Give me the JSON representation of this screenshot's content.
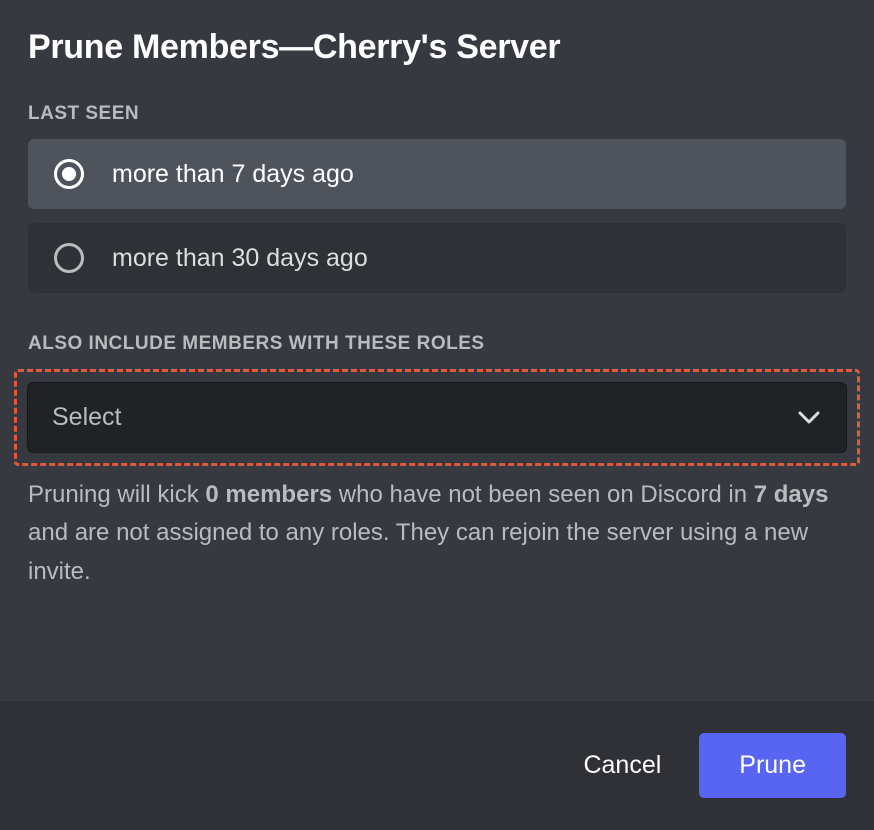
{
  "modal": {
    "title": "Prune Members—Cherry's Server"
  },
  "lastSeen": {
    "label": "Last Seen",
    "options": [
      {
        "label": "more than 7 days ago",
        "selected": true
      },
      {
        "label": "more than 30 days ago",
        "selected": false
      }
    ]
  },
  "rolesSection": {
    "label": "Also Include Members With These Roles",
    "placeholder": "Select"
  },
  "description": {
    "pre": "Pruning will kick ",
    "members": "0 members",
    "mid1": " who have not been seen on Discord in ",
    "days": "7 days",
    "post": " and are not assigned to any roles. They can rejoin the server using a new invite."
  },
  "footer": {
    "cancel": "Cancel",
    "prune": "Prune"
  }
}
